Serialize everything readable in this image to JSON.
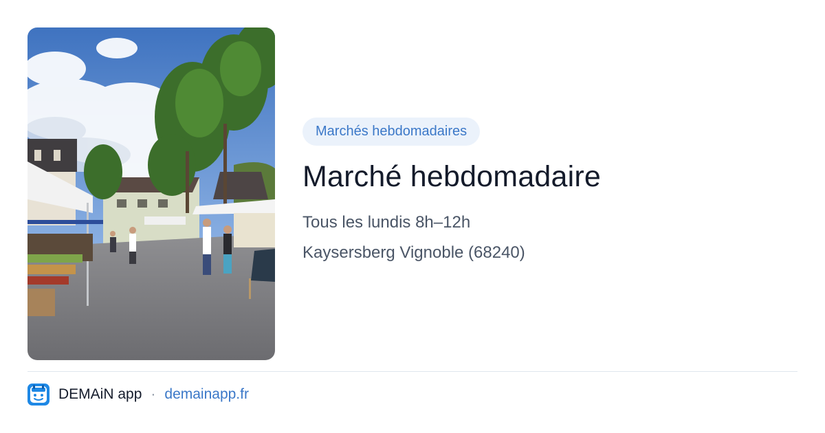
{
  "image": {
    "subject": "market-photo"
  },
  "category": {
    "label": "Marchés hebdomadaires"
  },
  "event": {
    "title": "Marché hebdomadaire",
    "schedule": "Tous les lundis 8h–12h",
    "location": "Kaysersberg Vignoble (68240)"
  },
  "footer": {
    "app_name": "DEMAiN app",
    "separator": "·",
    "link": "demainapp.fr",
    "logo_icon": "demain-logo-icon"
  },
  "colors": {
    "accent": "#3b78c8",
    "chip_bg": "#ebf2fb",
    "title": "#141b2b",
    "body_text": "#4a5566"
  }
}
